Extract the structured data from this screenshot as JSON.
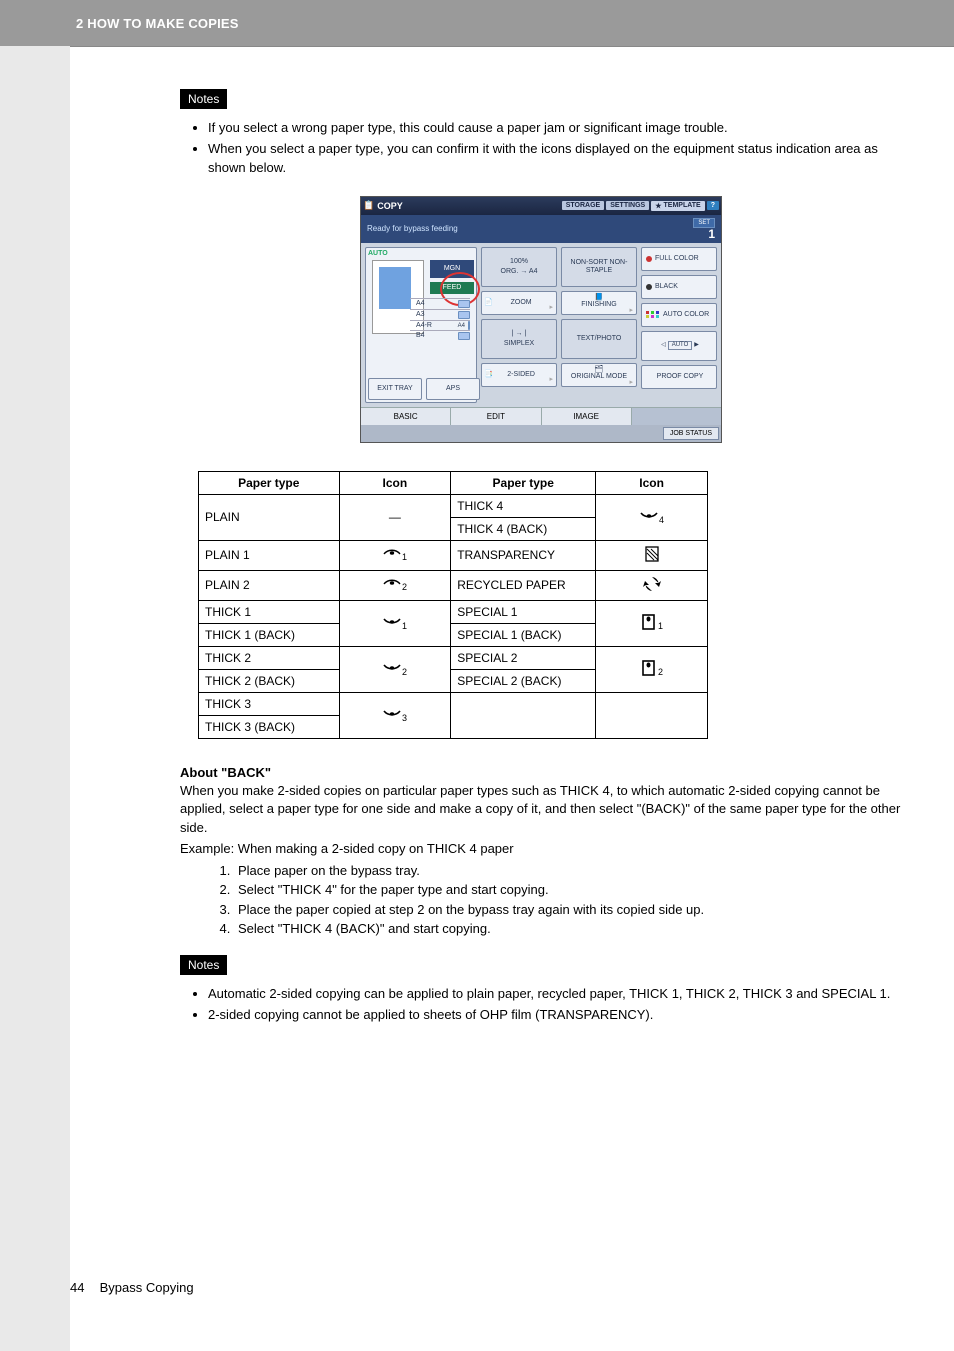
{
  "header": {
    "title": "2 HOW TO MAKE COPIES"
  },
  "notes_label": "Notes",
  "notes_top": [
    "If you select a wrong paper type, this could cause a paper jam or significant image trouble.",
    "When you select a paper type, you can confirm it with the icons displayed on the equipment status indication area as shown below."
  ],
  "panel": {
    "copy": "COPY",
    "top_buttons": {
      "storage": "STORAGE",
      "settings": "SETTINGS",
      "template": "TEMPLATE",
      "help": "?"
    },
    "status": "Ready for bypass feeding",
    "set": "SET",
    "set_count": "1",
    "auto": "AUTO",
    "mgn": "MGN",
    "feed": "FEED",
    "paper_sizes": [
      "A4",
      "A3",
      "A4-R",
      "B4"
    ],
    "a4_side": "A4",
    "exit_tray": "EXIT TRAY",
    "aps": "APS",
    "zoom_pct": "100%",
    "zoom_org": "ORG. → A4",
    "zoom": "ZOOM",
    "simplex_icon": "| → |",
    "simplex": "SIMPLEX",
    "two_sided": "2-SIDED",
    "nonsort": "NON-SORT NON-STAPLE",
    "finishing": "FINISHING",
    "textphoto": "TEXT/PHOTO",
    "original": "ORIGINAL MODE",
    "full_color": "FULL COLOR",
    "black": "BLACK",
    "auto_color": "AUTO COLOR",
    "auto_density": "AUTO",
    "proof": "PROOF COPY",
    "tabs": {
      "basic": "BASIC",
      "edit": "EDIT",
      "image": "IMAGE"
    },
    "job_status": "JOB STATUS"
  },
  "table": {
    "headers": {
      "paper_type": "Paper type",
      "icon": "Icon"
    },
    "left": [
      {
        "label": "PLAIN",
        "icon": "dash",
        "rowspan": 1
      },
      {
        "label": "PLAIN 1",
        "icon": "plain1",
        "rowspan": 1
      },
      {
        "label": "PLAIN 2",
        "icon": "plain2",
        "rowspan": 1
      },
      {
        "label": "THICK 1",
        "icon": "thick1",
        "rowspan": 2
      },
      {
        "label": "THICK 1 (BACK)"
      },
      {
        "label": "THICK 2",
        "icon": "thick2",
        "rowspan": 2
      },
      {
        "label": "THICK 2 (BACK)"
      },
      {
        "label": "THICK 3",
        "icon": "thick3",
        "rowspan": 2
      },
      {
        "label": "THICK 3 (BACK)"
      }
    ],
    "right": [
      {
        "label": "THICK 4",
        "icon": "thick4",
        "rowspan": 2
      },
      {
        "label": "THICK 4 (BACK)"
      },
      {
        "label": "TRANSPARENCY",
        "icon": "transparency",
        "rowspan": 1
      },
      {
        "label": "RECYCLED PAPER",
        "icon": "recycled",
        "rowspan": 1
      },
      {
        "label": "SPECIAL 1",
        "icon": "special1",
        "rowspan": 2
      },
      {
        "label": "SPECIAL 1 (BACK)"
      },
      {
        "label": "SPECIAL 2",
        "icon": "special2",
        "rowspan": 2
      },
      {
        "label": "SPECIAL 2 (BACK)"
      },
      {
        "label": "",
        "icon": "",
        "rowspan": 1,
        "blank": true
      }
    ]
  },
  "about": {
    "heading": "About \"BACK\"",
    "p1": "When you make 2-sided copies on particular paper types such as THICK 4, to which automatic 2-sided copying cannot be applied, select a paper type for one side and make a copy of it, and then select \"(BACK)\" of the same paper type for the other side.",
    "example": "Example: When making a 2-sided copy on THICK 4 paper",
    "steps": [
      "Place paper on the bypass tray.",
      "Select \"THICK 4\" for the paper type and start copying.",
      "Place the paper copied at step 2 on the bypass tray again with its copied side up.",
      "Select \"THICK 4 (BACK)\" and start copying."
    ]
  },
  "notes_bottom": [
    "Automatic 2-sided copying can be applied to plain paper, recycled paper, THICK 1, THICK 2, THICK 3 and SPECIAL 1.",
    "2-sided copying cannot be applied to sheets of OHP film (TRANSPARENCY)."
  ],
  "footer": {
    "page": "44",
    "title": "Bypass Copying"
  }
}
